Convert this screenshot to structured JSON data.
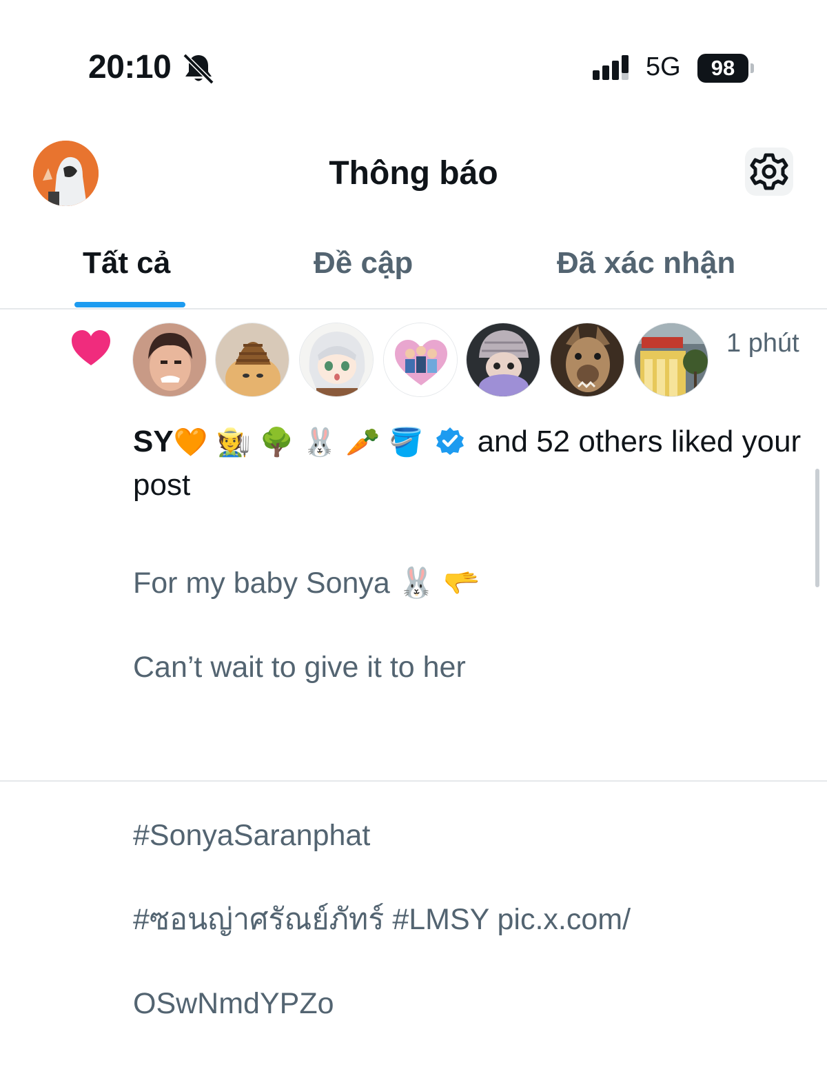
{
  "status_bar": {
    "time": "20:10",
    "network": "5G",
    "battery": "98",
    "icons": [
      "bell-muted-icon",
      "signal-icon"
    ]
  },
  "header": {
    "title": "Thông báo",
    "icons": [
      "avatar",
      "gear-icon"
    ]
  },
  "tabs": [
    {
      "label": "Tất cả",
      "active": true
    },
    {
      "label": "Đề cập",
      "active": false
    },
    {
      "label": "Đã xác nhận",
      "active": false
    }
  ],
  "colors": {
    "accent": "#1d9bf0",
    "heart": "#f02c7d",
    "verified": "#1d9bf0",
    "secondary_text": "#536471"
  },
  "notification": {
    "type_icon": "heart-icon",
    "time_ago": "1 phút",
    "liker_avatars": [
      "avatar-1",
      "avatar-2",
      "avatar-3",
      "avatar-4",
      "avatar-5",
      "avatar-6",
      "avatar-7"
    ],
    "user_name": "SY",
    "name_emojis": "🧡 🧑‍🌾 🌳 🐰 🥕 🪣",
    "summary_rest": "and 52 others liked your post",
    "post_line1": "For my baby Sonya 🐰 🫳",
    "post_line2": "Can’t wait to give it to her",
    "post_line3": "#SonyaSaranphat",
    "post_line4": "#ซอนญ่าศรัณย์ภัทร์ #LMSY pic.x.com/",
    "post_line5": "OSwNmdYPZo"
  }
}
